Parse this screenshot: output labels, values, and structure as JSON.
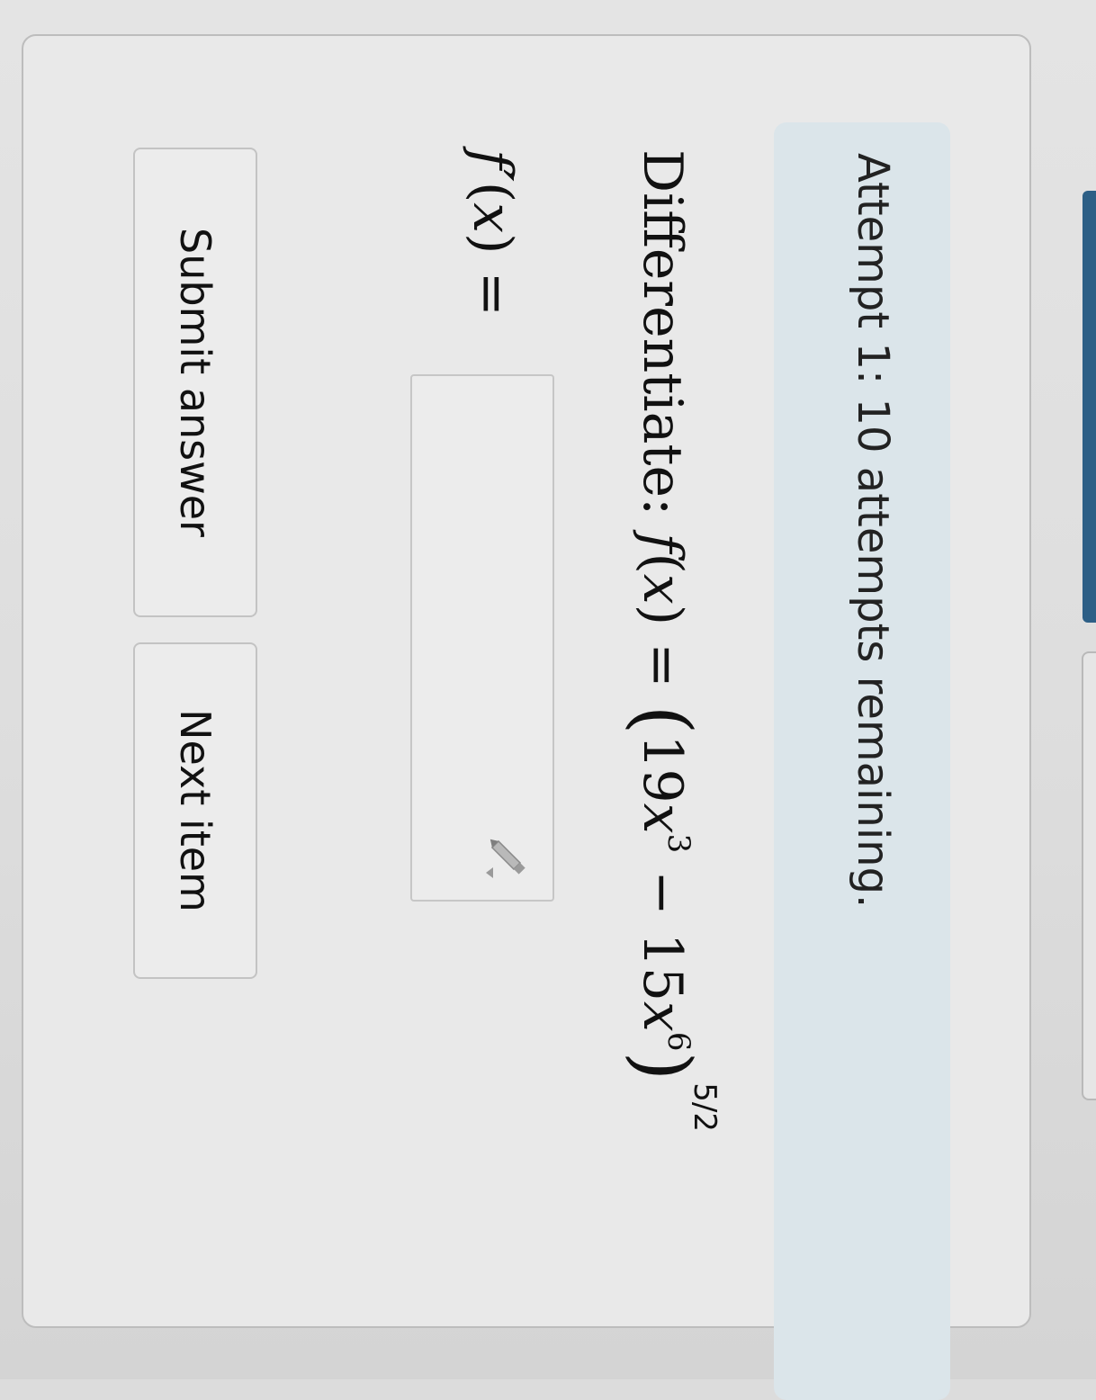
{
  "banner": {
    "text": "Attempt 1: 10 attempts remaining."
  },
  "question": {
    "prefix": "Differentiate:",
    "fn": "f",
    "var": "x",
    "equals": "=",
    "coef1": "19",
    "exp1": "3",
    "minus": "−",
    "coef2": "15",
    "exp2": "6",
    "outer_exp": "5/2"
  },
  "answer": {
    "label_fn": "f′",
    "label_var": "x",
    "label_equals": "=",
    "value": "",
    "input_icon": "pencil-icon"
  },
  "buttons": {
    "submit_label": "Submit answer",
    "next_label": "Next item"
  }
}
